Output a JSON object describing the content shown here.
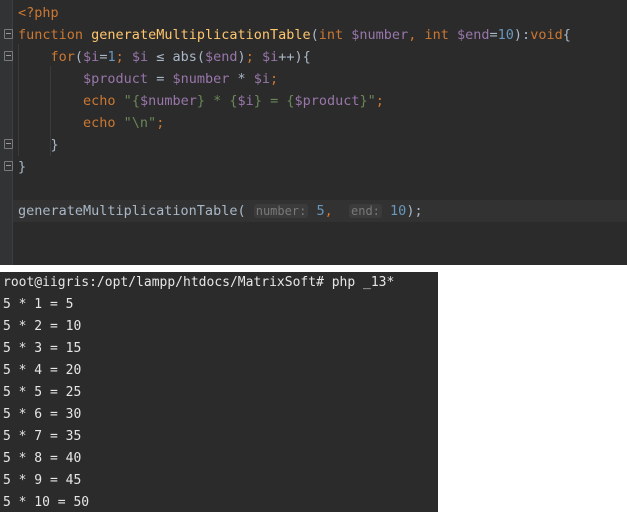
{
  "editor": {
    "lines": {
      "php_open": "<?php",
      "fn_kw": "function",
      "fn_name": "generateMultiplicationTable",
      "fn_paren_open": "(",
      "param1_type": "int",
      "param1_var": "$number",
      "comma1": ", ",
      "param2_type": "int",
      "param2_var": "$end",
      "param2_eq": "=",
      "param2_default": "10",
      "fn_paren_close": "):",
      "return_type": "void",
      "fn_brace": "{",
      "for_kw": "for",
      "for_paren_open": "(",
      "for_i1": "$i",
      "for_eq": "=",
      "for_one": "1",
      "for_semi1": "; ",
      "for_i2": "$i",
      "for_le": " ≤ ",
      "for_abs": "abs(",
      "for_end": "$end",
      "for_abs_close": ")",
      "for_semi2": "; ",
      "for_i3": "$i",
      "for_inc": "++){",
      "product_var": "$product",
      "product_eq": " = ",
      "product_number": "$number",
      "product_mul": " * ",
      "product_i": "$i",
      "product_semi": ";",
      "echo1_kw": "echo",
      "echo1_q_open": " \"",
      "echo1_b1o": "{",
      "echo1_number": "$number",
      "echo1_b1c": "}",
      "echo1_mid1": " * ",
      "echo1_b2o": "{",
      "echo1_i": "$i",
      "echo1_b2c": "}",
      "echo1_mid2": " = ",
      "echo1_b3o": "{",
      "echo1_product": "$product",
      "echo1_b3c": "}",
      "echo1_q_close": "\"",
      "echo1_semi": ";",
      "echo2_kw": "echo",
      "echo2_str": " \"\\n\"",
      "echo2_semi": ";",
      "for_close": "}",
      "fn_close": "}",
      "call_name": "generateMultiplicationTable",
      "call_paren": "(",
      "hint_number": "number:",
      "call_arg1": "5",
      "call_comma": ",",
      "hint_end": "end:",
      "call_arg2": "10",
      "call_close": ");"
    }
  },
  "terminal": {
    "prompt": "root@iigris:/opt/lampp/htdocs/MatrixSoft# php _13*",
    "output": [
      "5 * 1 = 5",
      "5 * 2 = 10",
      "5 * 3 = 15",
      "5 * 4 = 20",
      "5 * 5 = 25",
      "5 * 6 = 30",
      "5 * 7 = 35",
      "5 * 8 = 40",
      "5 * 9 = 45",
      "5 * 10 = 50"
    ]
  }
}
